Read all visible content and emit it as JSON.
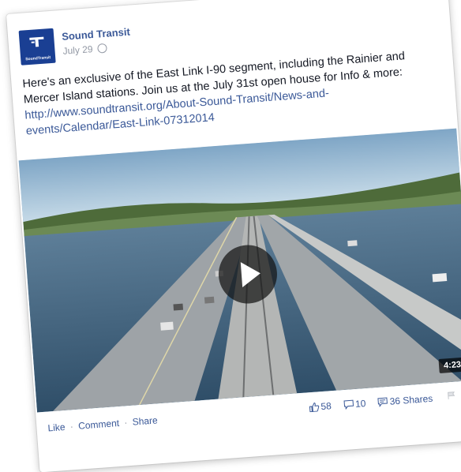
{
  "post": {
    "page_name": "Sound Transit",
    "date": "July 29",
    "avatar_text": "SoundTransit",
    "text_line1": "Here's an exclusive of the East Link I-90 segment, including the Rainier and",
    "text_line2": "Mercer Island stations. Join us at the July 31st open house for Info & more:",
    "link_line1": "http://www.soundtransit.org/About-Sound-Transit/News-and-",
    "link_line2": "events/Calendar/East-Link-07312014"
  },
  "video": {
    "duration": "4:23"
  },
  "actions": {
    "like": "Like",
    "comment": "Comment",
    "share": "Share",
    "separator": "·"
  },
  "stats": {
    "likes": "58",
    "comments": "10",
    "shares": "36 Shares"
  },
  "colors": {
    "link": "#3b5998",
    "brand": "#1a3f93",
    "meta": "#9197a3"
  }
}
